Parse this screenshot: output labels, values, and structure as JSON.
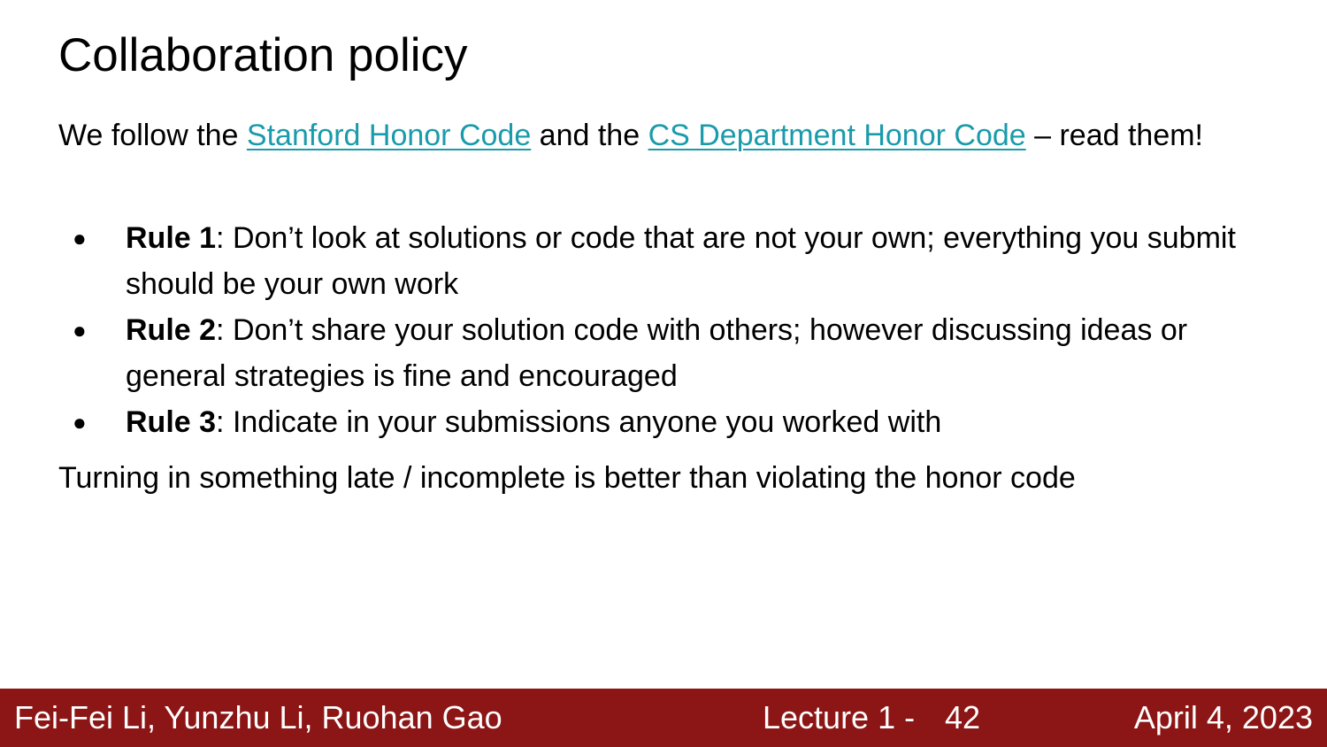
{
  "slide": {
    "title": "Collaboration policy",
    "intro": {
      "prefix": "We follow the ",
      "link1": "Stanford Honor Code",
      "middle": " and the ",
      "link2": "CS Department Honor Code",
      "suffix": " – read them!"
    },
    "rules": [
      {
        "name": "Rule 1",
        "text": ": Don’t look at solutions or code that are not your own; everything you submit should be your own work"
      },
      {
        "name": "Rule 2",
        "text": ": Don’t share your solution code with others; however discussing ideas or general strategies is fine and encouraged"
      },
      {
        "name": "Rule 3",
        "text": ": Indicate in your submissions anyone you worked with"
      }
    ],
    "bullet": "●",
    "closing": "Turning in something late / incomplete is better than violating the honor code"
  },
  "footer": {
    "authors": "Fei-Fei Li, Yunzhu Li, Ruohan Gao",
    "lecture": "Lecture 1 -",
    "page": "42",
    "date": "April 4, 2023"
  },
  "colors": {
    "footer_bg": "#8c1515",
    "link": "#1a9bab"
  }
}
